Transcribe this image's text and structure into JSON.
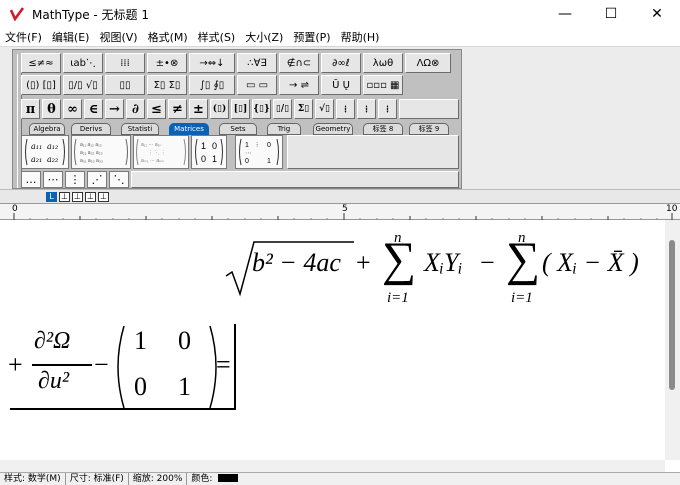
{
  "window": {
    "title": "MathType - 无标题 1",
    "minimize": "—",
    "maximize": "☐",
    "close": "✕"
  },
  "menu": [
    "文件(F)",
    "编辑(E)",
    "视图(V)",
    "格式(M)",
    "样式(S)",
    "大小(Z)",
    "预置(P)",
    "帮助(H)"
  ],
  "palette_row1": [
    "≤≠≈",
    "⍳ab⋱",
    "⁞⁞⁞",
    "±•⊗",
    "→⇔↓",
    "∴∀∃",
    "∉∩⊂",
    "∂∞ℓ",
    "λωθ",
    "ΛΩ⊗"
  ],
  "palette_row2": [
    "(▯) [▯]",
    "▯/▯ √▯",
    "▯▯",
    "Σ▯ Σ▯",
    "∫▯ ∮▯",
    "▭ ▭",
    "→ ⇌",
    "Ū Ų",
    "▫▫▫ ▦"
  ],
  "palette_row3": [
    "π",
    "θ",
    "∞",
    "∈",
    "→",
    "∂",
    "≤",
    "≠",
    "±",
    "(▯)",
    "[▯]",
    "{▯}",
    "▯/▯",
    "Σ▯",
    "√▯",
    "⁞",
    "⁞",
    "⁞"
  ],
  "tabs": [
    "Algebra",
    "Derivs",
    "Statisti",
    "Matrices",
    "Sets",
    "Trig",
    "Geometry",
    "标签 8",
    "标签 9"
  ],
  "active_tab": "Matrices",
  "small_buttons": [
    "…",
    "⋯",
    "⋮",
    "⋰",
    "⋱"
  ],
  "tab_stops": [
    "L",
    "⊥",
    "⊥",
    "⊥",
    "⊥"
  ],
  "ruler": {
    "marks": [
      "0",
      "5",
      "10"
    ]
  },
  "equation": {
    "line1": {
      "sqrt_content": "b² − 4ac",
      "sum1": {
        "upper": "n",
        "lower": "i=1",
        "body": "XᵢYᵢ"
      },
      "sum2": {
        "upper": "n",
        "lower": "i=1",
        "body": "( Xᵢ − X̄ )"
      }
    },
    "line2": {
      "prefix": "+",
      "frac_num": "∂²Ω",
      "frac_den": "∂u²",
      "minus": "−",
      "matrix": [
        [
          "1",
          "0"
        ],
        [
          "0",
          "1"
        ]
      ],
      "suffix": "="
    }
  },
  "status": {
    "style": "样式: 数学(M)",
    "size": "尺寸: 标准(F)",
    "zoom": "缩放: 200%",
    "color_label": "颜色:"
  },
  "colors": {
    "accent": "#0a62b8",
    "logo_red": "#d21c2b"
  }
}
